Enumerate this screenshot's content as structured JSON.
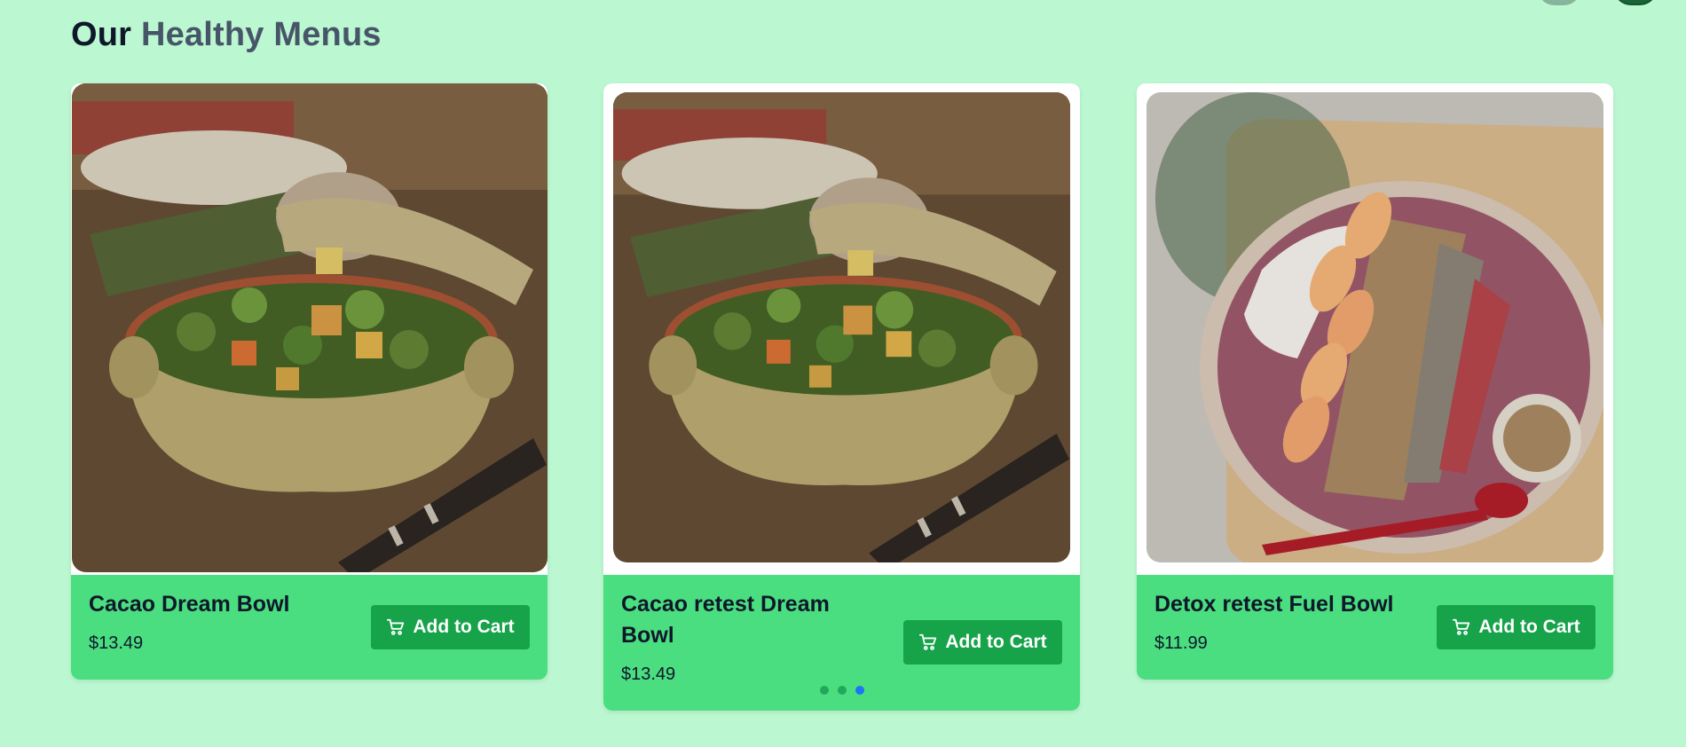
{
  "section": {
    "title_part1": "Our",
    "title_part2": "Healthy Menus"
  },
  "cards": [
    {
      "name": "Cacao Dream Bowl",
      "price": "$13.49",
      "button_label": "Add to Cart",
      "image": "casserole-bowl-vegetables"
    },
    {
      "name": "Cacao retest Dream Bowl",
      "price": "$13.49",
      "button_label": "Add to Cart",
      "image": "casserole-bowl-vegetables"
    },
    {
      "name": "Detox retest Fuel Bowl",
      "price": "$11.99",
      "button_label": "Add to Cart",
      "image": "acai-smoothie-bowl"
    }
  ],
  "carousel": {
    "dots": 3,
    "active_index": 2
  },
  "colors": {
    "page_bg": "#bbf7d0",
    "card_info_bg": "#4ade80",
    "button_bg": "#16a34a",
    "title_accent": "#475569",
    "dot_active": "#1d74f5"
  },
  "icons": {
    "cart": "cart-icon"
  }
}
